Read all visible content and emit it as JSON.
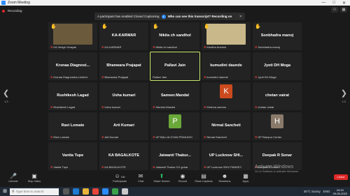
{
  "window": {
    "title": "Zoom Meeting"
  },
  "recording": {
    "label": "Recording"
  },
  "notification": {
    "message": "A participant has enabled Closed Captioning",
    "question": "Who can see this transcript? Recording on"
  },
  "tiles": [
    {
      "name": "",
      "label": "KA Vedgir Vinayak",
      "hand": true,
      "muted": true,
      "photo": "#6b5a3c"
    },
    {
      "name": "KA-KARWAR",
      "label": "KA-KARWAR",
      "hand": true,
      "muted": true
    },
    {
      "name": "Nikita ch sandhol",
      "label": "Nikita ch sandhol",
      "hand": true,
      "muted": true
    },
    {
      "name": "",
      "label": "Kavitha Aneesh",
      "hand": true,
      "muted": true,
      "photo": "#c9b98a"
    },
    {
      "name": "Sonbhadra manoj",
      "label": "Sonbhadra manoj",
      "hand": true,
      "muted": true
    },
    {
      "name": "Krsnaa  Diagnost...",
      "label": "Krsnaa Diagnostics Limited",
      "muted": true
    },
    {
      "name": "Bhanwara Prajapat",
      "label": "Bhanwara Prajapat",
      "muted": true
    },
    {
      "name": "Pallavi Jain",
      "label": "Pallavi Jain",
      "active": true
    },
    {
      "name": "kumudini daunde",
      "label": "kumudini daunde",
      "muted": true
    },
    {
      "name": "Jyoti DH Moga",
      "label": "Jyoti DH Moga",
      "muted": true
    },
    {
      "name": "Rushikesh Lagad",
      "label": "Rushikesh Lagad",
      "muted": true
    },
    {
      "name": "Usha kumari",
      "label": "Usha kumari",
      "muted": true
    },
    {
      "name": "Sameer.Mandal",
      "label": "Sameer.Mandal",
      "muted": true
    },
    {
      "name": "",
      "label": "Krishna zammu",
      "muted": true,
      "avatar": "K",
      "avatarColor": "#cc4a1e"
    },
    {
      "name": "chetan vairat",
      "label": "chetan vairat",
      "muted": true
    },
    {
      "name": "Ravi Lomate",
      "label": "Ravi Lomate",
      "muted": true
    },
    {
      "name": "Arti Kumari",
      "label": "Arti Kumari",
      "muted": true
    },
    {
      "name": "",
      "label": "UP BALLIA GYAN PRAKASH",
      "muted": true,
      "avatar": "P",
      "avatarColor": "#6aa83a"
    },
    {
      "name": "Nirmal Sancheti",
      "label": "Nirmal Sancheti",
      "muted": true
    },
    {
      "name": "",
      "label": "HP Rampur Center",
      "muted": true,
      "avatar": "H",
      "avatarColor": "#8a7a6a"
    },
    {
      "name": "Vanita Tupe",
      "label": "Vanita Tupe",
      "muted": true
    },
    {
      "name": "KA BAGALKOTE",
      "label": "KA BAGALKOTE",
      "muted": true
    },
    {
      "name": "Jaiwanti  Thakur...",
      "label": "Jaiwanti Thakur CH gohar",
      "muted": true
    },
    {
      "name": "UP  Lucknow  SHI...",
      "label": "UP Lucknow SHIV PANDEY",
      "muted": true
    },
    {
      "name": "Deepak R Sonar",
      "label": "Deepak R Sonar",
      "muted": true
    }
  ],
  "pager": {
    "left": "1/3",
    "right": "1/3"
  },
  "toolbar": {
    "unmute": "Unmute",
    "stop_video": "Stop Video",
    "participants": "Participants",
    "participants_count": "100",
    "chat": "Chat",
    "share_screen": "Share Screen",
    "record": "Record",
    "show_captions": "Show Captions",
    "reactions": "Reactions",
    "apps": "Apps",
    "leave": "Leave"
  },
  "watermark": {
    "title": "Activate Windows",
    "subtitle": "Go to Settings to activate Windows."
  },
  "taskbar": {
    "search_placeholder": "Type here to search",
    "weather": "36°C  Sunny",
    "language": "ENG",
    "time": "19:19",
    "date": "29-05-2023"
  }
}
